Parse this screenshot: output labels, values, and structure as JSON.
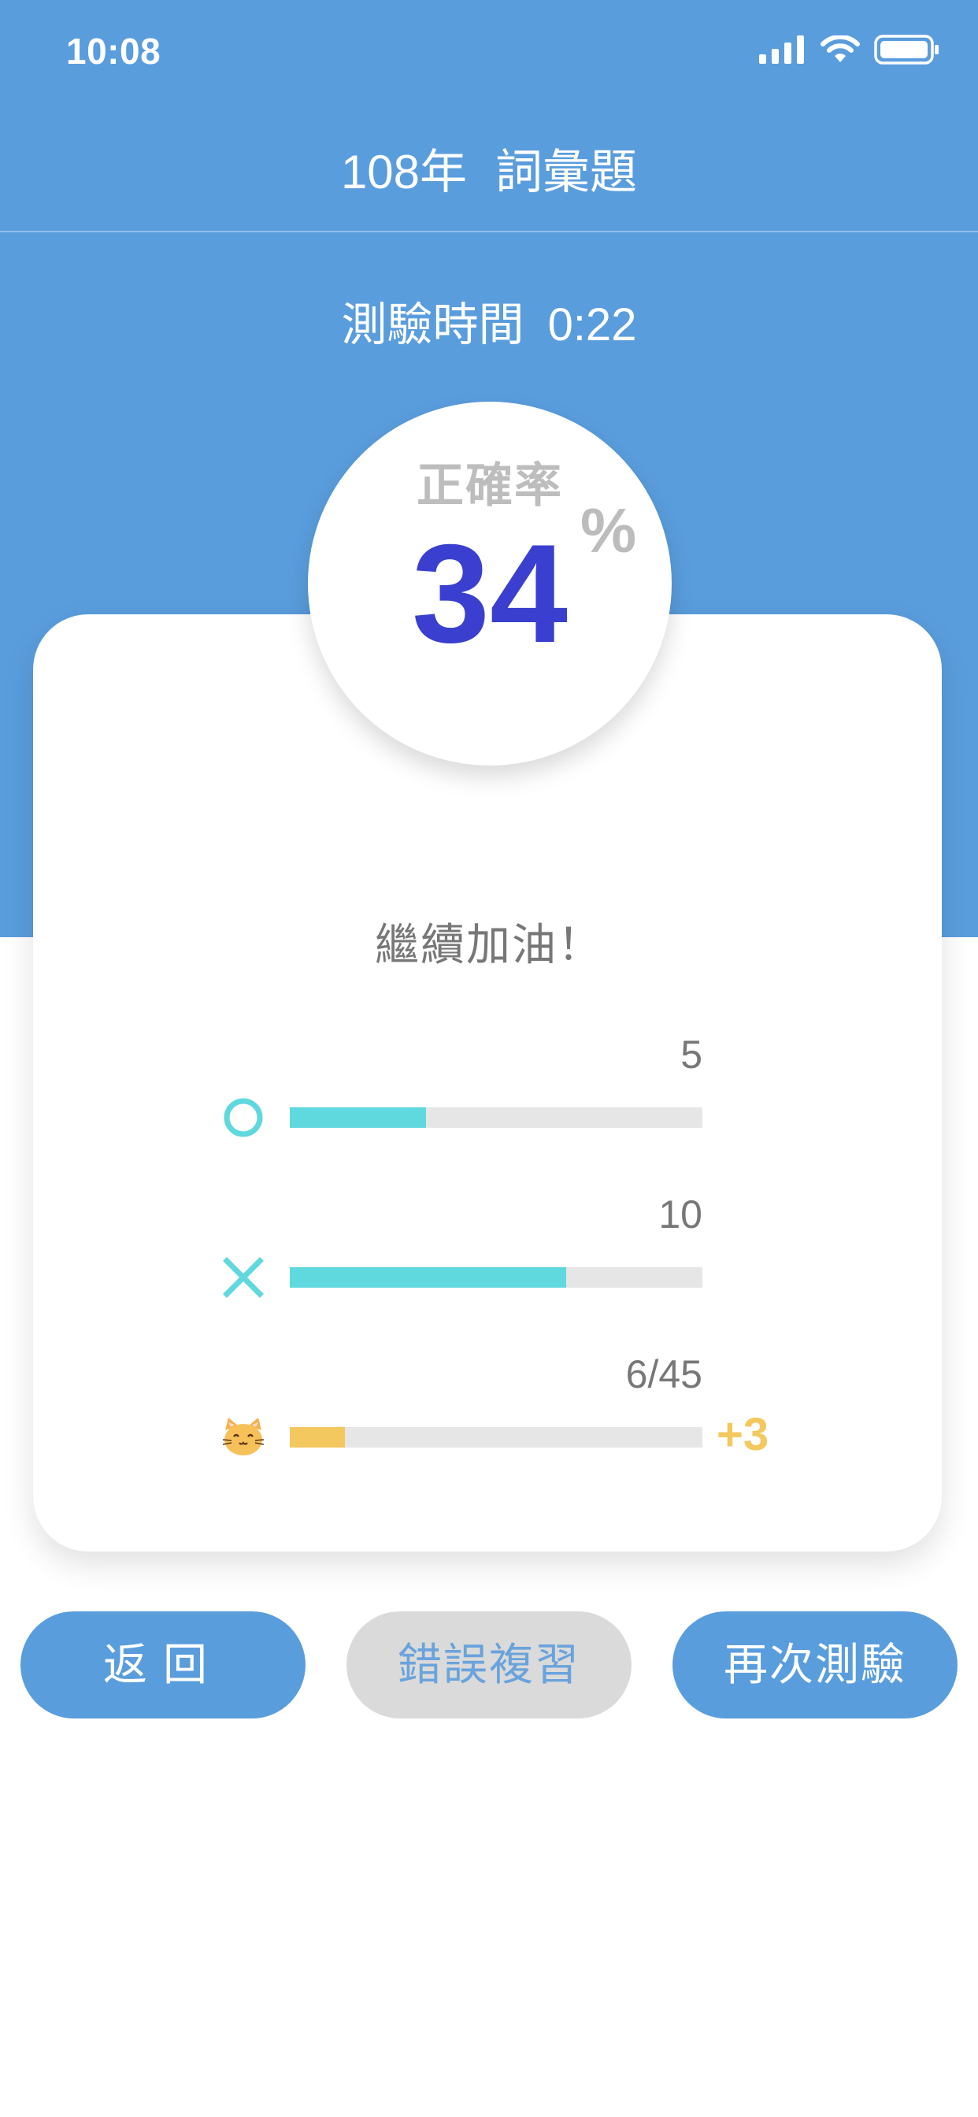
{
  "status_bar": {
    "time": "10:08"
  },
  "header": {
    "year": "108年",
    "title": "詞彙題"
  },
  "test_time": {
    "label": "測驗時間",
    "value": "0:22"
  },
  "accuracy": {
    "label": "正確率",
    "value": "34",
    "unit": "%"
  },
  "message": "繼續加油！",
  "stats": {
    "correct": {
      "count": "5",
      "fill_fraction": 0.33
    },
    "wrong": {
      "count": "10",
      "fill_fraction": 0.67
    },
    "cats": {
      "count": "6/45",
      "fill_fraction": 0.133,
      "bonus": "+3"
    }
  },
  "buttons": {
    "back": "返回",
    "review": "錯誤複習",
    "retry": "再次測驗"
  },
  "colors": {
    "primary_blue": "#5a9ddd",
    "accent_teal": "#5fd8de",
    "accent_yellow": "#f3c85f",
    "accuracy_blue": "#3b3fcf"
  }
}
